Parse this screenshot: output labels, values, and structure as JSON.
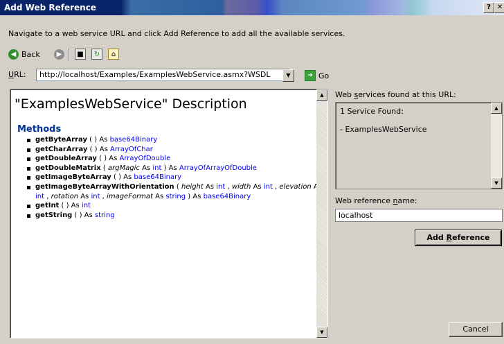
{
  "window": {
    "title": "Add Web Reference",
    "help_btn": "?",
    "close_btn": "✕"
  },
  "instruction": "Navigate to a web service URL and click Add Reference to add all the available services.",
  "toolbar": {
    "back_label": "Back"
  },
  "url": {
    "label_u": "U",
    "label_rest": "RL:",
    "value": "http://localhost/Examples/ExamplesWebService.asmx?WSDL",
    "go_label": "Go"
  },
  "doc": {
    "title": "\"ExamplesWebService\" Description",
    "methods_heading": "Methods",
    "methods": [
      {
        "parts": [
          {
            "t": "getByteArray",
            "c": "mname"
          },
          {
            "t": " ( ) As "
          },
          {
            "t": "base64Binary",
            "c": "link"
          }
        ]
      },
      {
        "parts": [
          {
            "t": "getCharArray",
            "c": "mname"
          },
          {
            "t": " ( ) As "
          },
          {
            "t": "ArrayOfChar",
            "c": "link"
          }
        ]
      },
      {
        "parts": [
          {
            "t": "getDoubleArray",
            "c": "mname"
          },
          {
            "t": " ( ) As "
          },
          {
            "t": "ArrayOfDouble",
            "c": "link"
          }
        ]
      },
      {
        "parts": [
          {
            "t": "getDoubleMatrix",
            "c": "mname"
          },
          {
            "t": " ( "
          },
          {
            "t": "argMagic",
            "c": "param"
          },
          {
            "t": " As "
          },
          {
            "t": "int",
            "c": "link"
          },
          {
            "t": " ) As "
          },
          {
            "t": "ArrayOfArrayOfDouble",
            "c": "link"
          }
        ]
      },
      {
        "parts": [
          {
            "t": "getImageByteArray",
            "c": "mname"
          },
          {
            "t": " ( ) As "
          },
          {
            "t": "base64Binary",
            "c": "link"
          }
        ]
      },
      {
        "parts": [
          {
            "t": "getImageByteArrayWithOrientation",
            "c": "mname"
          },
          {
            "t": " ( "
          },
          {
            "t": "height",
            "c": "param"
          },
          {
            "t": " As "
          },
          {
            "t": "int",
            "c": "link"
          },
          {
            "t": " , "
          },
          {
            "t": "width",
            "c": "param"
          },
          {
            "t": " As "
          },
          {
            "t": "int",
            "c": "link"
          },
          {
            "t": " , "
          },
          {
            "t": "elevation",
            "c": "param"
          },
          {
            "t": " As "
          },
          {
            "t": "int",
            "c": "link"
          },
          {
            "t": " , "
          },
          {
            "t": "rotation",
            "c": "param"
          },
          {
            "t": " As "
          },
          {
            "t": "int",
            "c": "link"
          },
          {
            "t": " , "
          },
          {
            "t": "imageFormat",
            "c": "param"
          },
          {
            "t": " As "
          },
          {
            "t": "string",
            "c": "link"
          },
          {
            "t": " ) As "
          },
          {
            "t": "base64Binary",
            "c": "link"
          }
        ]
      },
      {
        "parts": [
          {
            "t": "getInt",
            "c": "mname"
          },
          {
            "t": " ( ) As "
          },
          {
            "t": "int",
            "c": "link"
          }
        ]
      },
      {
        "parts": [
          {
            "t": "getString",
            "c": "mname"
          },
          {
            "t": " ( ) As "
          },
          {
            "t": "string",
            "c": "link"
          }
        ]
      }
    ]
  },
  "services": {
    "label_pre": "Web ",
    "label_u": "s",
    "label_post": "ervices found at this URL:",
    "count_text": "1 Service Found:",
    "items": [
      "- ExamplesWebService"
    ]
  },
  "refname": {
    "label_pre": "Web reference ",
    "label_u": "n",
    "label_post": "ame:",
    "value": "localhost"
  },
  "buttons": {
    "add_pre": "Add ",
    "add_u": "R",
    "add_post": "eference",
    "cancel": "Cancel"
  }
}
